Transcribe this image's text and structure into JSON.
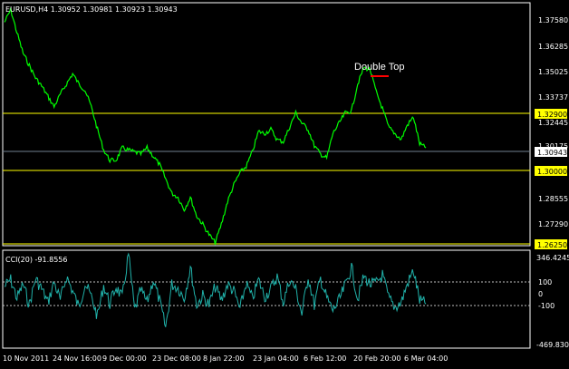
{
  "header": {
    "symbol_title": "EURUSD,H4  1.30952 1.30981 1.30923 1.30943",
    "indicator_title": "CCI(20) -91.8556"
  },
  "price_axis": {
    "labels": [
      "1.37580",
      "1.36285",
      "1.35025",
      "1.33737",
      "1.32445",
      "1.28555",
      "1.27290"
    ],
    "current_price": "1.30943",
    "top_tick_partial": "1.30175"
  },
  "levels": [
    {
      "label": "1.32900",
      "value": 1.329,
      "color": "#ffff00"
    },
    {
      "label": "1.30000",
      "value": 1.3,
      "color": "#ffff00"
    },
    {
      "label": "1.26250",
      "value": 1.2625,
      "color": "#ffff00"
    }
  ],
  "annotation": {
    "text": "Double Top"
  },
  "cci_axis": {
    "labels": [
      "346.4245",
      "100",
      "0",
      "-100",
      "-469.8309"
    ]
  },
  "time_axis": {
    "labels": [
      "10 Nov 2011",
      "24 Nov 16:00",
      "9 Dec 00:00",
      "23 Dec 08:00",
      "8 Jan 22:00",
      "23 Jan 04:00",
      "6 Feb 12:00",
      "20 Feb 20:00",
      "6 Mar 04:00"
    ]
  },
  "colors": {
    "price_line": "#00ff00",
    "cci_line": "#20b2aa",
    "level_line": "#ffff00",
    "current_price_line": "#708090",
    "annotation_marker": "#ff0000",
    "grid_text": "#ffffff"
  },
  "chart_data": [
    {
      "type": "line",
      "series": [
        {
          "values": [
            1.37,
            1.376,
            1.365,
            1.355,
            1.349,
            1.343,
            1.339,
            1.334,
            1.329,
            1.335,
            1.34,
            1.345,
            1.34,
            1.337,
            1.329,
            1.318,
            1.308,
            1.303,
            1.303,
            1.309,
            1.308,
            1.307,
            1.306,
            1.309,
            1.305,
            1.301,
            1.294,
            1.287,
            1.285,
            1.279,
            1.285,
            1.276,
            1.272,
            1.267,
            1.263,
            1.272,
            1.283,
            1.291,
            1.297,
            1.3,
            1.307,
            1.317,
            1.316,
            1.318,
            1.313,
            1.312,
            1.319,
            1.326,
            1.321,
            1.318,
            1.31,
            1.306,
            1.304,
            1.316,
            1.321,
            1.326,
            1.327,
            1.34,
            1.348,
            1.347,
            1.336,
            1.328,
            1.319,
            1.316,
            1.313,
            1.32,
            1.324,
            1.311,
            1.309
          ]
        }
      ],
      "ylim": [
        1.262,
        1.379
      ]
    },
    {
      "type": "line",
      "series": [
        {
          "values": [
            60,
            120,
            -40,
            80,
            -100,
            130,
            40,
            -80,
            100,
            -60,
            150,
            20,
            -120,
            90,
            -30,
            -200,
            70,
            -90,
            60,
            -40,
            346,
            -150,
            30,
            -80,
            120,
            -60,
            -300,
            80,
            50,
            -40,
            230,
            -100,
            -20,
            -100,
            60,
            -60,
            80,
            20,
            -140,
            90,
            -50,
            120,
            -30,
            40,
            150,
            -80,
            120,
            40,
            -180,
            150,
            -100,
            130,
            -40,
            -150,
            -60,
            70,
            230,
            -50,
            150,
            80,
            90,
            160,
            -40,
            -120,
            -80,
            80,
            200,
            -60,
            -92
          ]
        }
      ],
      "ylim": [
        -469.8309,
        346.4245
      ]
    }
  ]
}
